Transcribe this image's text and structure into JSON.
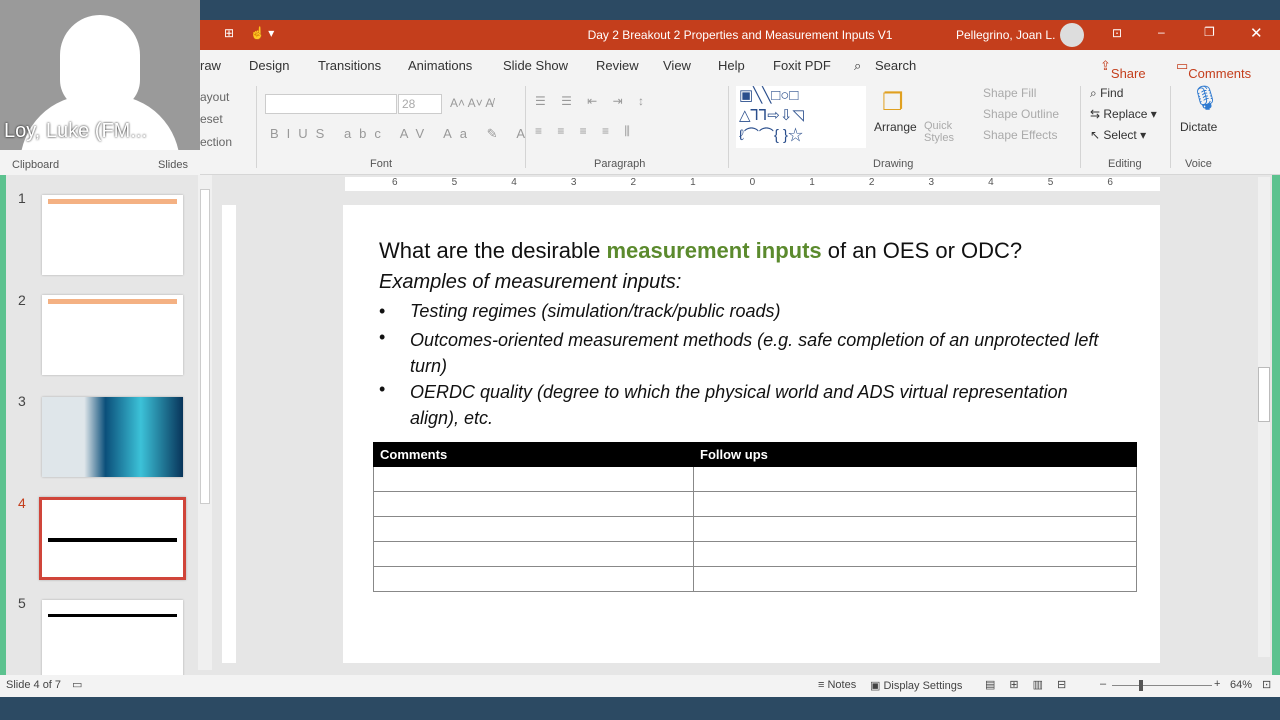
{
  "window": {
    "title": "Day 2 Breakout 2 Properties and Measurement Inputs V1",
    "user": "Pellegrino, Joan L."
  },
  "video": {
    "participant": "Loy, Luke (FM..."
  },
  "tabs": [
    "raw",
    "Design",
    "Transitions",
    "Animations",
    "Slide Show",
    "Review",
    "View",
    "Help",
    "Foxit PDF"
  ],
  "search": "Search",
  "share": "Share",
  "comments": "Comments",
  "ribbon": {
    "layout": "ayout",
    "reset": "eset",
    "section": "ection",
    "font_size": "28",
    "arrange": "Arrange",
    "quick_styles": "Quick Styles",
    "shape_fill": "Shape Fill",
    "shape_outline": "Shape Outline",
    "shape_effects": "Shape Effects",
    "find": "Find",
    "replace": "Replace",
    "select": "Select",
    "dictate": "Dictate",
    "groups": {
      "clipboard": "Clipboard",
      "slides": "Slides",
      "font": "Font",
      "paragraph": "Paragraph",
      "drawing": "Drawing",
      "editing": "Editing",
      "voice": "Voice"
    }
  },
  "thumbnails": [
    "1",
    "2",
    "3",
    "4",
    "5"
  ],
  "ruler": [
    "6",
    "5",
    "4",
    "3",
    "2",
    "1",
    "0",
    "1",
    "2",
    "3",
    "4",
    "5",
    "6"
  ],
  "slide": {
    "title_pre": "What are the desirable ",
    "title_hl": "measurement inputs",
    "title_post": " of an OES or ODC?",
    "accent": "#5b8a2d",
    "subtitle": "Examples of measurement inputs:",
    "bullets": [
      "Testing regimes (simulation/track/public roads)",
      "Outcomes-oriented measurement methods (e.g. safe completion of an unprotected left turn)",
      "OERDC quality (degree to which the physical world and ADS virtual representation align), etc."
    ],
    "table": {
      "headers": [
        "Comments",
        "Follow ups"
      ],
      "rows": 5
    }
  },
  "status": {
    "slide": "Slide 4 of 7",
    "notes": "Notes",
    "display": "Display Settings",
    "zoom": "64%"
  }
}
